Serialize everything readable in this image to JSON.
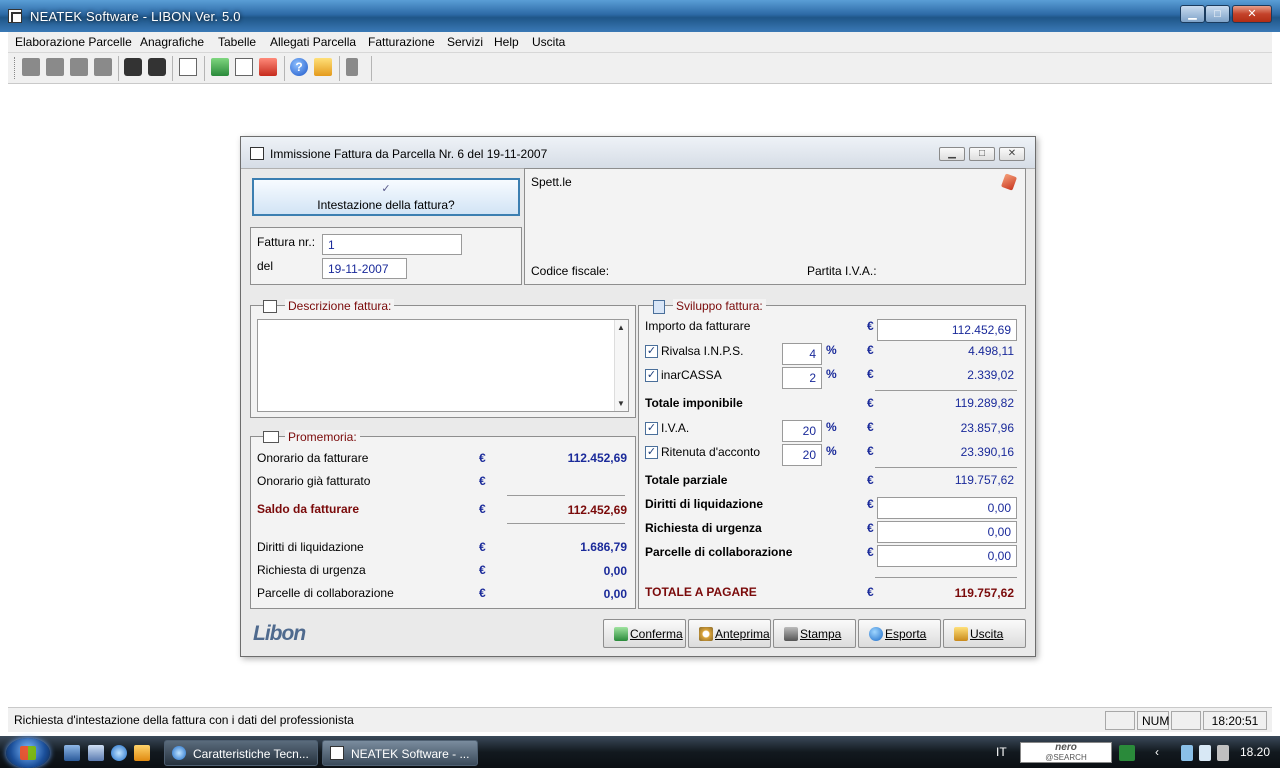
{
  "window": {
    "title": "NEATEK Software  -  LIBON Ver. 5.0",
    "min_label": "▁",
    "max_label": "□",
    "close_label": "✕"
  },
  "menu": [
    "Elaborazione Parcelle",
    "Anagrafiche",
    "Tabelle",
    "Allegati Parcella",
    "Fatturazione",
    "Servizi",
    "Help",
    "Uscita"
  ],
  "dialog": {
    "title": "Immissione Fattura da Parcella Nr. 6  del 19-11-2007",
    "intestazione_label": "Intestazione della fattura?",
    "fattura_nr_label": "Fattura nr.:",
    "fattura_nr_value": "1",
    "del_label": "del",
    "del_value": "19-11-2007",
    "spettle_label": "Spett.le",
    "codice_fiscale_label": "Codice fiscale:",
    "partita_iva_label": "Partita I.V.A.:",
    "descrizione_title": "Descrizione fattura:",
    "promemoria": {
      "title": "Promemoria:",
      "rows": [
        {
          "label": "Onorario da fatturare",
          "currency": "€",
          "value": "112.452,69"
        },
        {
          "label": "Onorario già fatturato",
          "currency": "€",
          "value": ""
        },
        {
          "label": "Saldo da fatturare",
          "currency": "€",
          "value": "112.452,69"
        },
        {
          "label": "Diritti di liquidazione",
          "currency": "€",
          "value": "1.686,79"
        },
        {
          "label": "Richiesta di urgenza",
          "currency": "€",
          "value": "0,00"
        },
        {
          "label": "Parcelle di collaborazione",
          "currency": "€",
          "value": "0,00"
        }
      ]
    },
    "sviluppo": {
      "title": "Sviluppo fattura:",
      "currency": "€",
      "percent": "%",
      "importo_label": "Importo da fatturare",
      "importo_value": "112.452,69",
      "rivalsa_label": "Rivalsa I.N.P.S.",
      "rivalsa_pct": "4",
      "rivalsa_value": "4.498,11",
      "inarcassa_label": "inarCASSA",
      "inarcassa_pct": "2",
      "inarcassa_value": "2.339,02",
      "totale_imponibile_label": "Totale imponibile",
      "totale_imponibile_value": "119.289,82",
      "iva_label": "I.V.A.",
      "iva_pct": "20",
      "iva_value": "23.857,96",
      "ritenuta_label": "Ritenuta d'acconto",
      "ritenuta_pct": "20",
      "ritenuta_value": "23.390,16",
      "totale_parziale_label": "Totale parziale",
      "totale_parziale_value": "119.757,62",
      "diritti_label": "Diritti di liquidazione",
      "diritti_value": "0,00",
      "urgenza_label": "Richiesta di urgenza",
      "urgenza_value": "0,00",
      "collaborazione_label": "Parcelle di collaborazione",
      "collaborazione_value": "0,00",
      "totale_pagare_label": "TOTALE A PAGARE",
      "totale_pagare_value": "119.757,62"
    },
    "logo_text": "Libon",
    "buttons": {
      "conferma": "Conferma",
      "anteprima": "Anteprima",
      "stampa": "Stampa",
      "esporta": "Esporta",
      "uscita": "Uscita"
    }
  },
  "statusbar": {
    "message": "Richiesta d'intestazione della fattura con i dati del professionista",
    "num": "NUM",
    "time": "18:20:51"
  },
  "taskbar": {
    "task1": "Caratteristiche Tecn...",
    "task2": "NEATEK Software  - ...",
    "lang": "IT",
    "nero_line1": "nero",
    "nero_line2": "@SEARCH",
    "clock": "18.20"
  }
}
